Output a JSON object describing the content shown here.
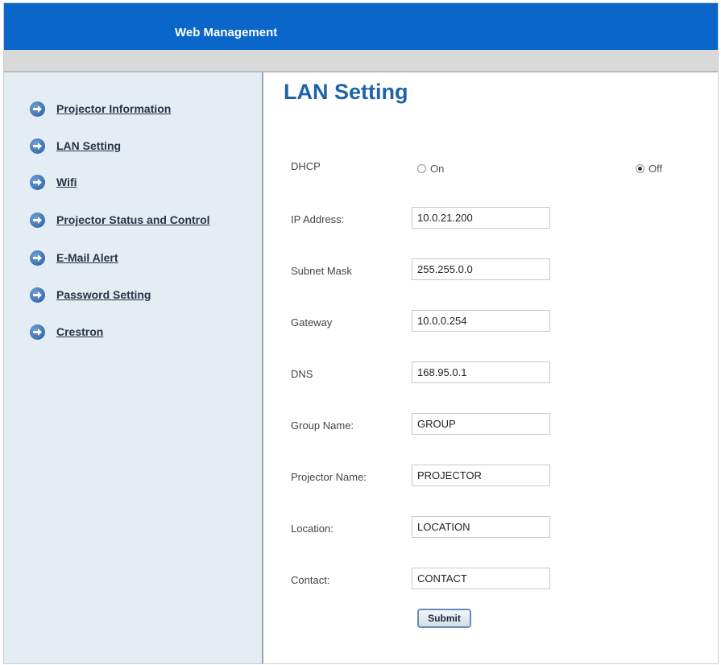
{
  "header": {
    "title": "Web Management"
  },
  "sidebar": {
    "items": [
      {
        "label": "Projector Information"
      },
      {
        "label": "LAN Setting"
      },
      {
        "label": "Wifi"
      },
      {
        "label": "Projector Status and Control"
      },
      {
        "label": "E-Mail Alert"
      },
      {
        "label": "Password Setting"
      },
      {
        "label": "Crestron"
      }
    ]
  },
  "main": {
    "title": "LAN Setting",
    "dhcp": {
      "label": "DHCP",
      "on_label": "On",
      "off_label": "Off",
      "selected": "Off"
    },
    "fields": [
      {
        "label": "IP Address:",
        "value": "10.0.21.200"
      },
      {
        "label": "Subnet Mask",
        "value": "255.255.0.0"
      },
      {
        "label": "Gateway",
        "value": "10.0.0.254"
      },
      {
        "label": "DNS",
        "value": "168.95.0.1"
      },
      {
        "label": "Group Name:",
        "value": "GROUP"
      },
      {
        "label": "Projector Name:",
        "value": "PROJECTOR"
      },
      {
        "label": "Location:",
        "value": "LOCATION"
      },
      {
        "label": "Contact:",
        "value": "CONTACT"
      }
    ],
    "submit_label": "Submit"
  },
  "colors": {
    "header": "#0a66c8",
    "sidebar_bg": "#e5edf4",
    "title_blue": "#1e63a8"
  }
}
